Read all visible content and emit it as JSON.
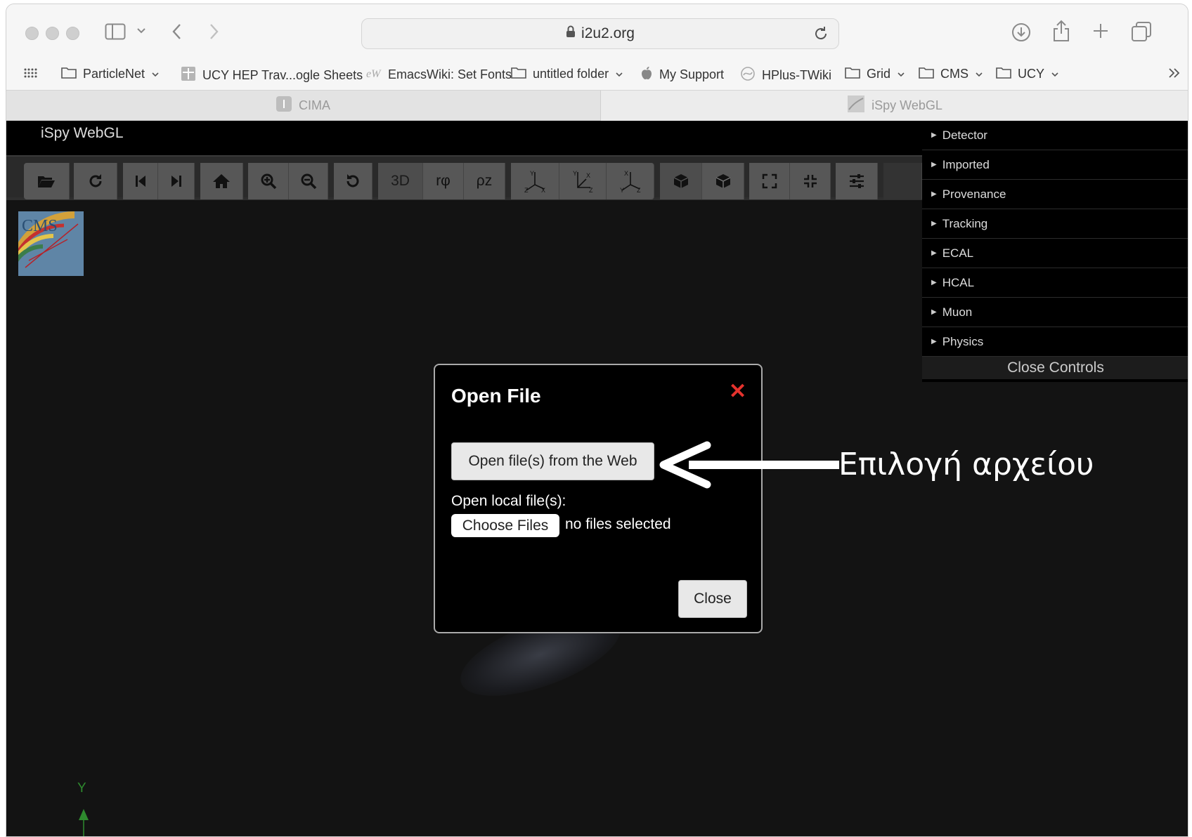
{
  "browser": {
    "url": "i2u2.org",
    "bookmarks": [
      {
        "label": "ParticleNet",
        "icon": "folder-icon",
        "dropdown": true
      },
      {
        "label": "UCY HEP Trav...ogle Sheets",
        "icon": "sheets-icon",
        "dropdown": false
      },
      {
        "label": "EmacsWiki: Set Fonts",
        "icon": "site-icon",
        "dropdown": false
      },
      {
        "label": "untitled folder",
        "icon": "folder-icon",
        "dropdown": true
      },
      {
        "label": "My Support",
        "icon": "apple-icon",
        "dropdown": false
      },
      {
        "label": "HPlus-TWiki",
        "icon": "site-icon",
        "dropdown": false
      },
      {
        "label": "Grid",
        "icon": "folder-icon",
        "dropdown": true
      },
      {
        "label": "CMS",
        "icon": "folder-icon",
        "dropdown": true
      },
      {
        "label": "UCY",
        "icon": "folder-icon",
        "dropdown": true
      }
    ],
    "tabs": [
      {
        "label": "CIMA",
        "active": true
      },
      {
        "label": "iSpy WebGL",
        "active": false
      }
    ]
  },
  "app": {
    "title": "iSpy WebGL",
    "toolbar": {
      "view_3d": "3D",
      "view_rphi": "rφ",
      "view_rz": "ρz"
    },
    "controls": {
      "sections": [
        "Detector",
        "Imported",
        "Provenance",
        "Tracking",
        "ECAL",
        "HCAL",
        "Muon",
        "Physics"
      ],
      "close_label": "Close Controls"
    },
    "axis_label": "Y"
  },
  "modal": {
    "title": "Open File",
    "web_button": "Open file(s) from the Web",
    "local_label": "Open local file(s):",
    "choose_button": "Choose Files",
    "no_files": "no files selected",
    "close_button": "Close"
  },
  "annotation": {
    "text": "Επιλογή αρχείου"
  },
  "colors": {
    "close_x": "#e5322d",
    "app_bg": "#131313",
    "axis_green": "#2e8a2e"
  }
}
